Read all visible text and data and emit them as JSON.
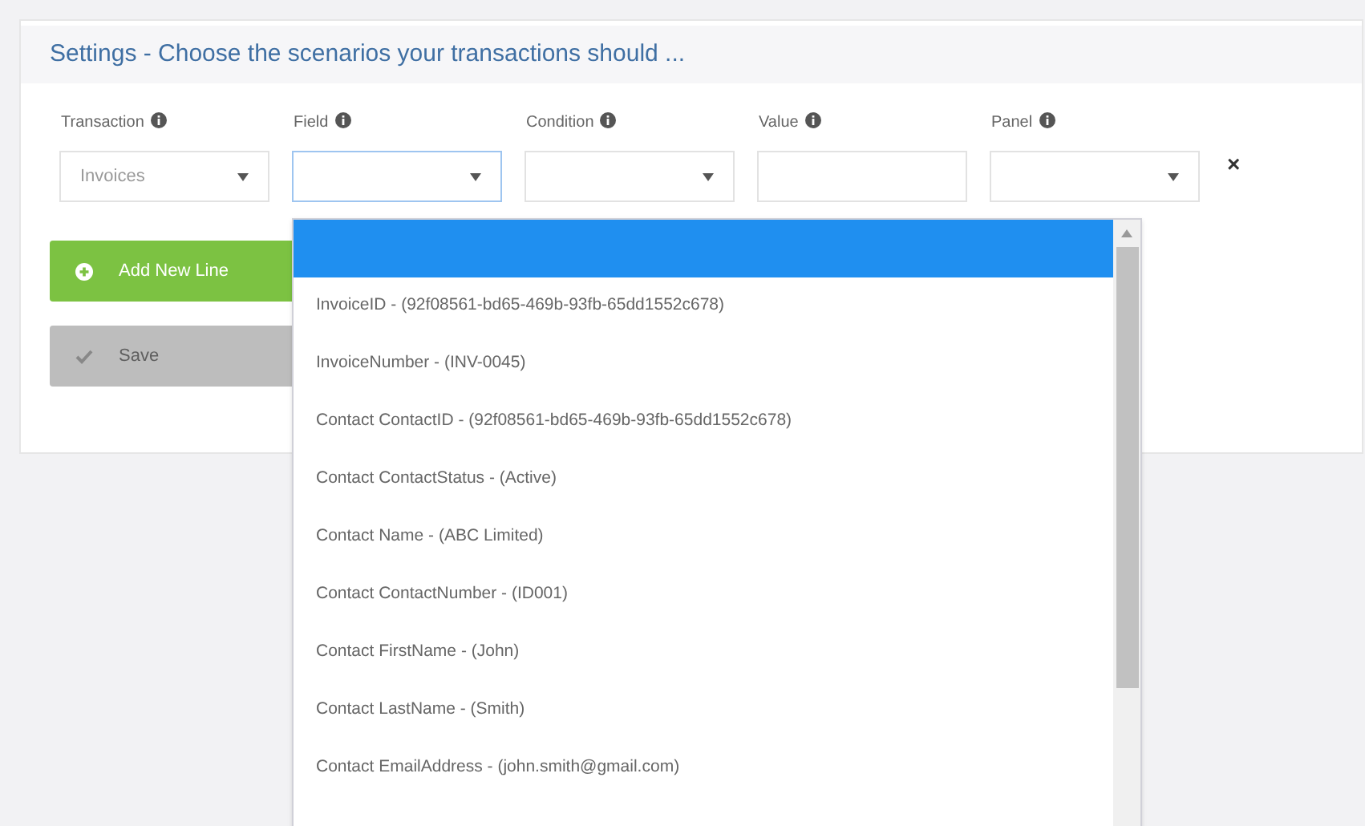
{
  "card": {
    "title": "Settings - Choose the scenarios your transactions should ..."
  },
  "columns": [
    {
      "label": "Transaction",
      "kind": "select",
      "value": "Invoices",
      "open": false
    },
    {
      "label": "Field",
      "kind": "select",
      "open": true
    },
    {
      "label": "Condition",
      "kind": "select",
      "open": false
    },
    {
      "label": "Value",
      "kind": "input",
      "open": false
    },
    {
      "label": "Panel",
      "kind": "select",
      "open": false
    }
  ],
  "remove_line": {
    "label": "×"
  },
  "buttons": [
    {
      "label": "Add New Line",
      "kind": "add",
      "disabled": false
    },
    {
      "label": "Save",
      "kind": "save",
      "disabled": true
    }
  ],
  "dropdown": {
    "options": [
      {
        "selected": true
      },
      {
        "label": "InvoiceID - (92f08561-bd65-469b-93fb-65dd1552c678)",
        "selected": false
      },
      {
        "label": "InvoiceNumber - (INV-0045)",
        "selected": false
      },
      {
        "label": "Contact ContactID - (92f08561-bd65-469b-93fb-65dd1552c678)",
        "selected": false
      },
      {
        "label": "Contact ContactStatus - (Active)",
        "selected": false
      },
      {
        "label": "Contact Name - (ABC Limited)",
        "selected": false
      },
      {
        "label": "Contact ContactNumber - (ID001)",
        "selected": false
      },
      {
        "label": "Contact FirstName - (John)",
        "selected": false
      },
      {
        "label": "Contact LastName - (Smith)",
        "selected": false
      },
      {
        "label": "Contact EmailAddress - (john.smith@gmail.com)",
        "selected": false
      }
    ]
  }
}
